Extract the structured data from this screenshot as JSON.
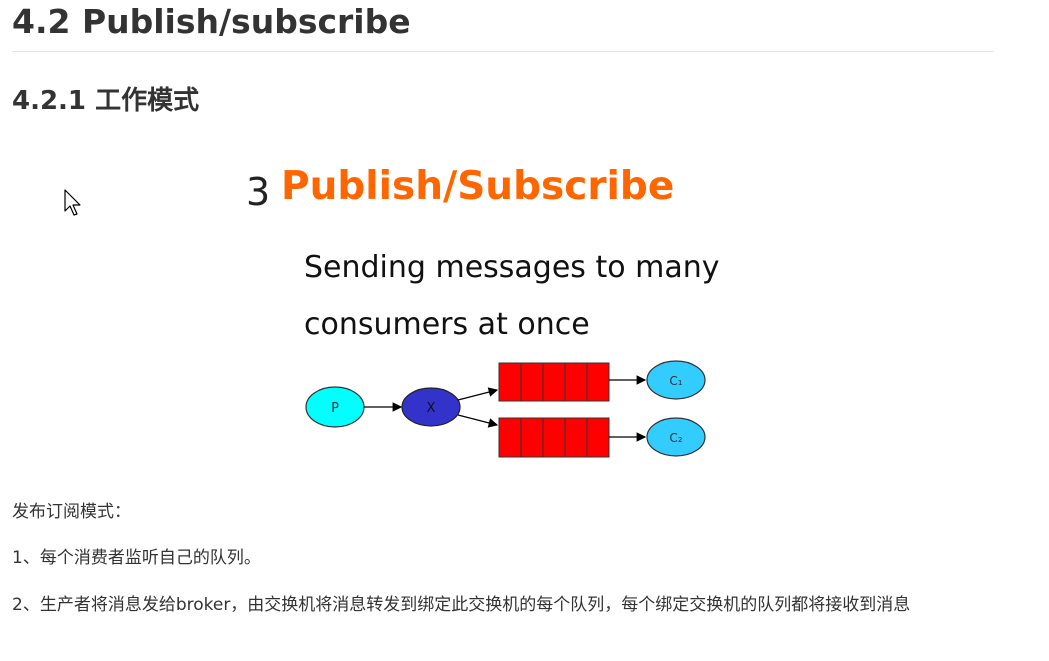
{
  "heading": "4.2 Publish/subscribe",
  "subheading": "4.2.1 工作模式",
  "figure": {
    "number": "3",
    "title": "Publish/Subscribe",
    "subtitle_line1": "Sending messages to many",
    "subtitle_line2": "consumers at once",
    "nodes": {
      "producer": "P",
      "exchange": "X",
      "consumer1": "C₁",
      "consumer2": "C₂"
    },
    "colors": {
      "title": "#ff6600",
      "producer": "#00ffff",
      "exchange": "#3333cc",
      "queue": "#ff0000",
      "consumer": "#33ccff"
    }
  },
  "paragraphs": {
    "intro": "发布订阅模式：",
    "point1": "1、每个消费者监听自己的队列。",
    "point2": "2、生产者将消息发给broker，由交换机将消息转发到绑定此交换机的每个队列，每个绑定交换机的队列都将接收到消息"
  }
}
